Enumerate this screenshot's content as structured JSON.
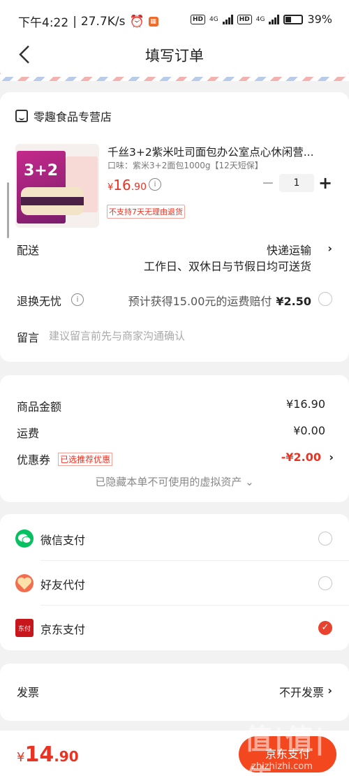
{
  "status_bar": {
    "time": "下午4:22",
    "speed": "27.7K/s",
    "net1": "4G",
    "net2": "4G",
    "battery": "39%"
  },
  "nav": {
    "title": "填写订单"
  },
  "store": {
    "name": "零趣食品专营店"
  },
  "product": {
    "title": "千丝3+2紫米吐司面包办公室点心休闲营...",
    "spec": "口味：紫米3+2面包1000g【12天短保】",
    "price_currency": "¥",
    "price_int": "16",
    "price_dec": ".90",
    "quantity": "1",
    "minus": "−",
    "plus": "+",
    "img_label": "3+2",
    "no_return": "不支持7天无理由退货"
  },
  "delivery": {
    "label": "配送",
    "method": "快递运输",
    "schedule": "工作日、双休日与节假日均可送货"
  },
  "return_service": {
    "label": "退换无忧",
    "text": "预计获得15.00元的运费赔付",
    "price": "¥2.50"
  },
  "message": {
    "label": "留言",
    "placeholder": "建议留言前先与商家沟通确认"
  },
  "summary": {
    "goods_label": "商品金额",
    "goods_value": "¥16.90",
    "freight_label": "运费",
    "freight_value": "¥0.00",
    "coupon_label": "优惠券",
    "coupon_tag": "已选推荐优惠",
    "coupon_value": "-¥2.00",
    "hidden_note": "已隐藏本单不可使用的虚拟资产 ⌄"
  },
  "payment": {
    "options": [
      {
        "label": "微信支付",
        "selected": false
      },
      {
        "label": "好友代付",
        "selected": false
      },
      {
        "label": "京东支付",
        "selected": true
      }
    ],
    "jd_icon_text": "东付"
  },
  "invoice": {
    "label": "发票",
    "value": "不开发票"
  },
  "bottom": {
    "currency": "¥",
    "total_int": "14",
    "total_dec": ".90",
    "pay_button": "京东支付",
    "watermark": "值|值|值",
    "watermark_site": "zhizhizhi.com"
  },
  "colors": {
    "accent": "#e93323",
    "button": "#f3471f",
    "wechat": "#07c160"
  }
}
